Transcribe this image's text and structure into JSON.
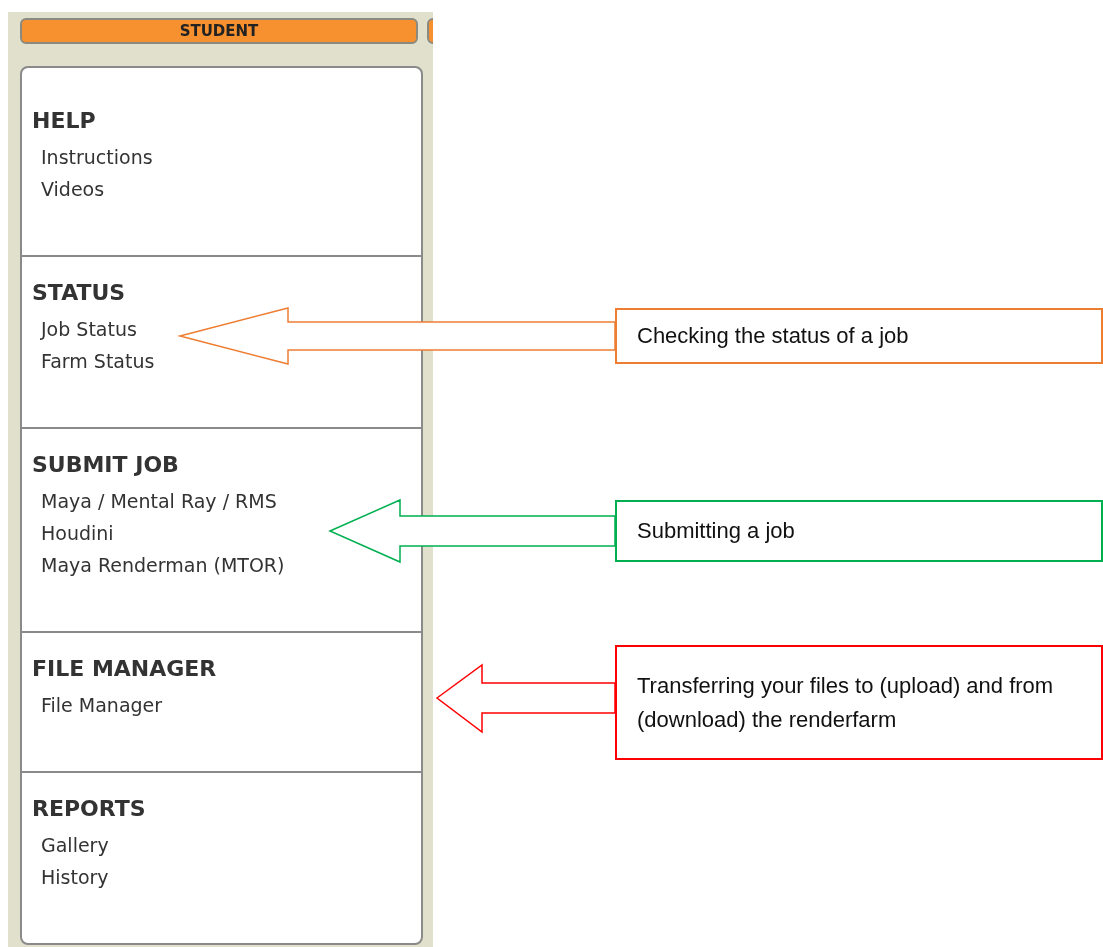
{
  "tabs": [
    {
      "label": "STUDENT"
    }
  ],
  "sections": [
    {
      "heading": "HELP",
      "items": [
        "Instructions",
        "Videos"
      ]
    },
    {
      "heading": "STATUS",
      "items": [
        "Job Status",
        "Farm Status"
      ]
    },
    {
      "heading": "SUBMIT JOB",
      "items": [
        "Maya / Mental Ray / RMS",
        "Houdini",
        "Maya Renderman (MTOR)"
      ]
    },
    {
      "heading": "FILE MANAGER",
      "items": [
        "File Manager"
      ]
    },
    {
      "heading": "REPORTS",
      "items": [
        "Gallery",
        "History"
      ]
    }
  ],
  "callouts": [
    {
      "text": "Checking the status of a job",
      "color": "#ed7d31"
    },
    {
      "text": "Submitting a job",
      "color": "#00b050"
    },
    {
      "text": "Transferring your files to (upload) and from (download) the renderfarm",
      "color": "#ff0000"
    }
  ]
}
